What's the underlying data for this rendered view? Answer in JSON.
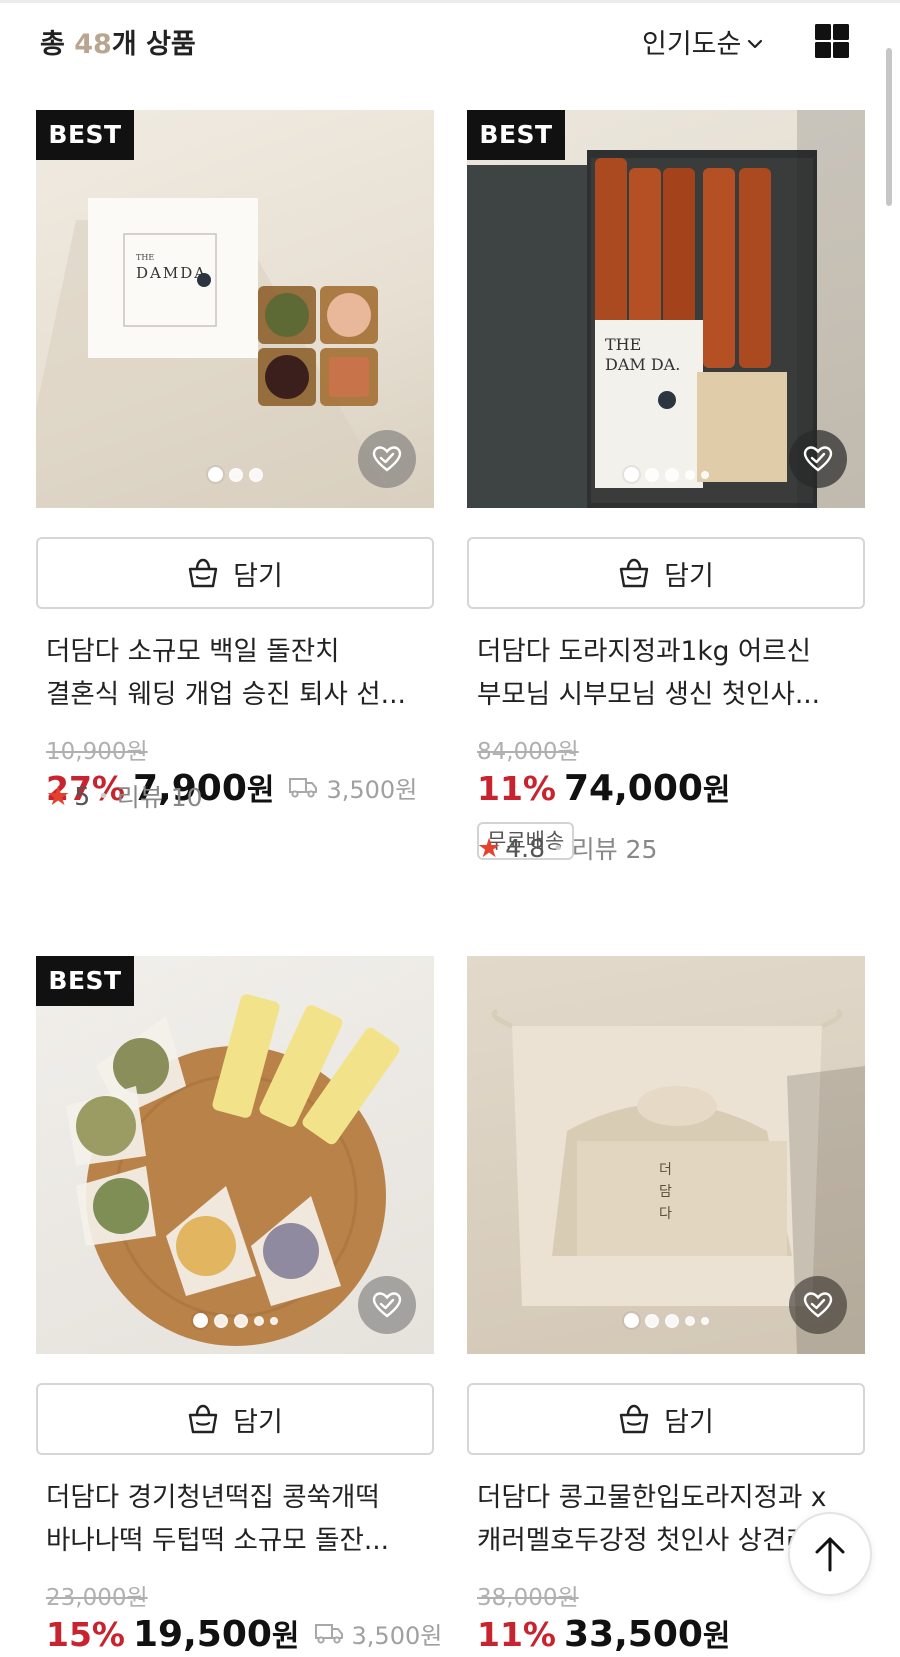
{
  "header": {
    "count_prefix": "총 ",
    "count_value": "48",
    "count_suffix": "개 상품",
    "sort_label": "인기도순",
    "sort_icon": "chevron-down-icon",
    "view_icon": "grid-view-icon"
  },
  "products": [
    {
      "badge": "BEST",
      "cart_label": "담기",
      "title_line1": "더담다 소규모 백일 돌잔치",
      "title_line2": "결혼식 웨딩 개업 승진 퇴사 선...",
      "original_price": "10,900원",
      "discount": "27%",
      "price": "7,900",
      "currency": "원",
      "shipping_fee": "3,500원",
      "free_shipping": "",
      "rating": "5",
      "review_label": "리뷰 10",
      "dots": 3,
      "active_dot": 0
    },
    {
      "badge": "BEST",
      "cart_label": "담기",
      "title_line1": "더담다 도라지정과1kg 어르신",
      "title_line2": "부모님 시부모님 생신 첫인사...",
      "original_price": "84,000원",
      "discount": "11%",
      "price": "74,000",
      "currency": "원",
      "shipping_fee": "",
      "free_shipping": "무료배송",
      "rating": "4.8",
      "review_label": "리뷰 25",
      "dots": 5,
      "active_dot": 0
    },
    {
      "badge": "BEST",
      "cart_label": "담기",
      "title_line1": "더담다 경기청년떡집 콩쑥개떡",
      "title_line2": "바나나떡 두텁떡 소규모 돌잔...",
      "original_price": "23,000원",
      "discount": "15%",
      "price": "19,500",
      "currency": "원",
      "shipping_fee": "3,500원",
      "free_shipping": "",
      "rating": "",
      "review_label": "",
      "dots": 5,
      "active_dot": 0
    },
    {
      "badge": "",
      "cart_label": "담기",
      "title_line1": "더담다 콩고물한입도라지정과 x",
      "title_line2": "캐러멜호두강정 첫인사 상견례",
      "original_price": "38,000원",
      "discount": "11%",
      "price": "33,500",
      "currency": "원",
      "shipping_fee": "",
      "free_shipping": "",
      "rating": "",
      "review_label": "",
      "dots": 5,
      "active_dot": 0
    }
  ],
  "icons": {
    "cart": "shopping-bag-icon",
    "wish": "heart-check-icon",
    "shipping": "delivery-truck-icon",
    "star": "star-icon",
    "scroll_top": "arrow-up-icon"
  },
  "colors": {
    "discount": "#c7242f",
    "count_accent": "#b8a690",
    "star": "#e5412e"
  }
}
